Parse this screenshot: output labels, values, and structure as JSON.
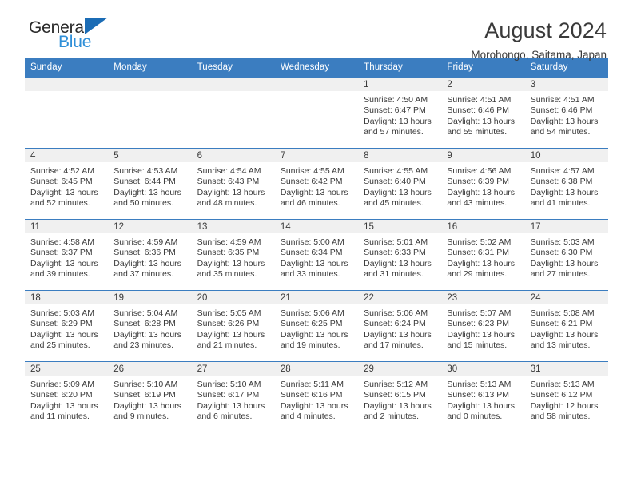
{
  "brand": {
    "line1": "General",
    "line2": "Blue",
    "triangle_color": "#1b6cb5",
    "blue_color": "#2f8fd8"
  },
  "header": {
    "title": "August 2024",
    "subtitle": "Morohongo, Saitama, Japan"
  },
  "colors": {
    "header_row": "#3b7dc0",
    "daynum_band": "#f0f0f0",
    "text": "#3a3a3a"
  },
  "weekday_headers": [
    "Sunday",
    "Monday",
    "Tuesday",
    "Wednesday",
    "Thursday",
    "Friday",
    "Saturday"
  ],
  "weeks": [
    [
      {
        "day": "",
        "sunrise": "",
        "sunset": "",
        "daylight_line1": "",
        "daylight_line2": ""
      },
      {
        "day": "",
        "sunrise": "",
        "sunset": "",
        "daylight_line1": "",
        "daylight_line2": ""
      },
      {
        "day": "",
        "sunrise": "",
        "sunset": "",
        "daylight_line1": "",
        "daylight_line2": ""
      },
      {
        "day": "",
        "sunrise": "",
        "sunset": "",
        "daylight_line1": "",
        "daylight_line2": ""
      },
      {
        "day": "1",
        "sunrise": "Sunrise: 4:50 AM",
        "sunset": "Sunset: 6:47 PM",
        "daylight_line1": "Daylight: 13 hours",
        "daylight_line2": "and 57 minutes."
      },
      {
        "day": "2",
        "sunrise": "Sunrise: 4:51 AM",
        "sunset": "Sunset: 6:46 PM",
        "daylight_line1": "Daylight: 13 hours",
        "daylight_line2": "and 55 minutes."
      },
      {
        "day": "3",
        "sunrise": "Sunrise: 4:51 AM",
        "sunset": "Sunset: 6:46 PM",
        "daylight_line1": "Daylight: 13 hours",
        "daylight_line2": "and 54 minutes."
      }
    ],
    [
      {
        "day": "4",
        "sunrise": "Sunrise: 4:52 AM",
        "sunset": "Sunset: 6:45 PM",
        "daylight_line1": "Daylight: 13 hours",
        "daylight_line2": "and 52 minutes."
      },
      {
        "day": "5",
        "sunrise": "Sunrise: 4:53 AM",
        "sunset": "Sunset: 6:44 PM",
        "daylight_line1": "Daylight: 13 hours",
        "daylight_line2": "and 50 minutes."
      },
      {
        "day": "6",
        "sunrise": "Sunrise: 4:54 AM",
        "sunset": "Sunset: 6:43 PM",
        "daylight_line1": "Daylight: 13 hours",
        "daylight_line2": "and 48 minutes."
      },
      {
        "day": "7",
        "sunrise": "Sunrise: 4:55 AM",
        "sunset": "Sunset: 6:42 PM",
        "daylight_line1": "Daylight: 13 hours",
        "daylight_line2": "and 46 minutes."
      },
      {
        "day": "8",
        "sunrise": "Sunrise: 4:55 AM",
        "sunset": "Sunset: 6:40 PM",
        "daylight_line1": "Daylight: 13 hours",
        "daylight_line2": "and 45 minutes."
      },
      {
        "day": "9",
        "sunrise": "Sunrise: 4:56 AM",
        "sunset": "Sunset: 6:39 PM",
        "daylight_line1": "Daylight: 13 hours",
        "daylight_line2": "and 43 minutes."
      },
      {
        "day": "10",
        "sunrise": "Sunrise: 4:57 AM",
        "sunset": "Sunset: 6:38 PM",
        "daylight_line1": "Daylight: 13 hours",
        "daylight_line2": "and 41 minutes."
      }
    ],
    [
      {
        "day": "11",
        "sunrise": "Sunrise: 4:58 AM",
        "sunset": "Sunset: 6:37 PM",
        "daylight_line1": "Daylight: 13 hours",
        "daylight_line2": "and 39 minutes."
      },
      {
        "day": "12",
        "sunrise": "Sunrise: 4:59 AM",
        "sunset": "Sunset: 6:36 PM",
        "daylight_line1": "Daylight: 13 hours",
        "daylight_line2": "and 37 minutes."
      },
      {
        "day": "13",
        "sunrise": "Sunrise: 4:59 AM",
        "sunset": "Sunset: 6:35 PM",
        "daylight_line1": "Daylight: 13 hours",
        "daylight_line2": "and 35 minutes."
      },
      {
        "day": "14",
        "sunrise": "Sunrise: 5:00 AM",
        "sunset": "Sunset: 6:34 PM",
        "daylight_line1": "Daylight: 13 hours",
        "daylight_line2": "and 33 minutes."
      },
      {
        "day": "15",
        "sunrise": "Sunrise: 5:01 AM",
        "sunset": "Sunset: 6:33 PM",
        "daylight_line1": "Daylight: 13 hours",
        "daylight_line2": "and 31 minutes."
      },
      {
        "day": "16",
        "sunrise": "Sunrise: 5:02 AM",
        "sunset": "Sunset: 6:31 PM",
        "daylight_line1": "Daylight: 13 hours",
        "daylight_line2": "and 29 minutes."
      },
      {
        "day": "17",
        "sunrise": "Sunrise: 5:03 AM",
        "sunset": "Sunset: 6:30 PM",
        "daylight_line1": "Daylight: 13 hours",
        "daylight_line2": "and 27 minutes."
      }
    ],
    [
      {
        "day": "18",
        "sunrise": "Sunrise: 5:03 AM",
        "sunset": "Sunset: 6:29 PM",
        "daylight_line1": "Daylight: 13 hours",
        "daylight_line2": "and 25 minutes."
      },
      {
        "day": "19",
        "sunrise": "Sunrise: 5:04 AM",
        "sunset": "Sunset: 6:28 PM",
        "daylight_line1": "Daylight: 13 hours",
        "daylight_line2": "and 23 minutes."
      },
      {
        "day": "20",
        "sunrise": "Sunrise: 5:05 AM",
        "sunset": "Sunset: 6:26 PM",
        "daylight_line1": "Daylight: 13 hours",
        "daylight_line2": "and 21 minutes."
      },
      {
        "day": "21",
        "sunrise": "Sunrise: 5:06 AM",
        "sunset": "Sunset: 6:25 PM",
        "daylight_line1": "Daylight: 13 hours",
        "daylight_line2": "and 19 minutes."
      },
      {
        "day": "22",
        "sunrise": "Sunrise: 5:06 AM",
        "sunset": "Sunset: 6:24 PM",
        "daylight_line1": "Daylight: 13 hours",
        "daylight_line2": "and 17 minutes."
      },
      {
        "day": "23",
        "sunrise": "Sunrise: 5:07 AM",
        "sunset": "Sunset: 6:23 PM",
        "daylight_line1": "Daylight: 13 hours",
        "daylight_line2": "and 15 minutes."
      },
      {
        "day": "24",
        "sunrise": "Sunrise: 5:08 AM",
        "sunset": "Sunset: 6:21 PM",
        "daylight_line1": "Daylight: 13 hours",
        "daylight_line2": "and 13 minutes."
      }
    ],
    [
      {
        "day": "25",
        "sunrise": "Sunrise: 5:09 AM",
        "sunset": "Sunset: 6:20 PM",
        "daylight_line1": "Daylight: 13 hours",
        "daylight_line2": "and 11 minutes."
      },
      {
        "day": "26",
        "sunrise": "Sunrise: 5:10 AM",
        "sunset": "Sunset: 6:19 PM",
        "daylight_line1": "Daylight: 13 hours",
        "daylight_line2": "and 9 minutes."
      },
      {
        "day": "27",
        "sunrise": "Sunrise: 5:10 AM",
        "sunset": "Sunset: 6:17 PM",
        "daylight_line1": "Daylight: 13 hours",
        "daylight_line2": "and 6 minutes."
      },
      {
        "day": "28",
        "sunrise": "Sunrise: 5:11 AM",
        "sunset": "Sunset: 6:16 PM",
        "daylight_line1": "Daylight: 13 hours",
        "daylight_line2": "and 4 minutes."
      },
      {
        "day": "29",
        "sunrise": "Sunrise: 5:12 AM",
        "sunset": "Sunset: 6:15 PM",
        "daylight_line1": "Daylight: 13 hours",
        "daylight_line2": "and 2 minutes."
      },
      {
        "day": "30",
        "sunrise": "Sunrise: 5:13 AM",
        "sunset": "Sunset: 6:13 PM",
        "daylight_line1": "Daylight: 13 hours",
        "daylight_line2": "and 0 minutes."
      },
      {
        "day": "31",
        "sunrise": "Sunrise: 5:13 AM",
        "sunset": "Sunset: 6:12 PM",
        "daylight_line1": "Daylight: 12 hours",
        "daylight_line2": "and 58 minutes."
      }
    ]
  ]
}
